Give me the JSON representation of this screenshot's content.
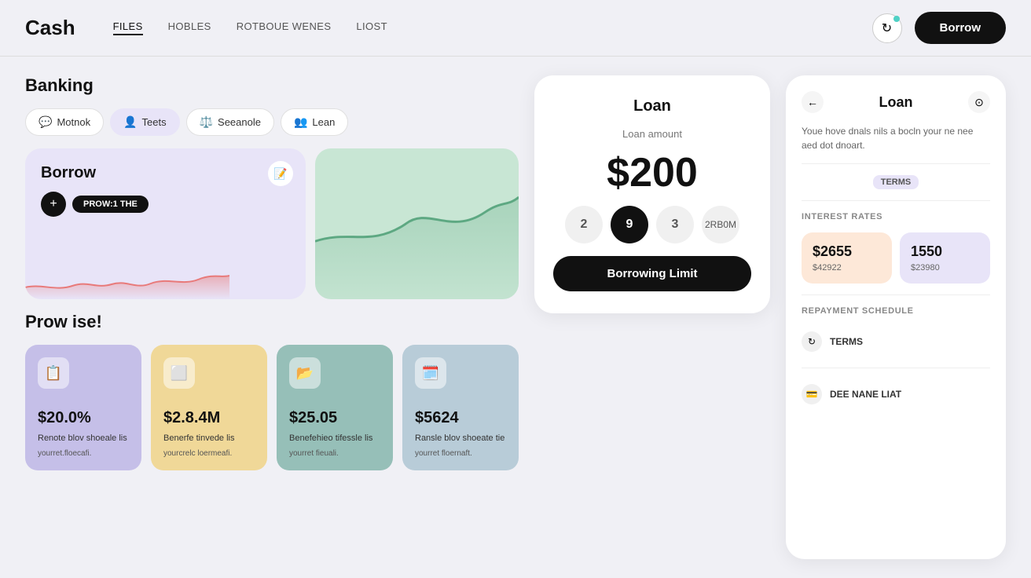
{
  "header": {
    "logo": "Cash",
    "nav": [
      {
        "label": "FILES",
        "active": true
      },
      {
        "label": "HOBLES",
        "active": false
      },
      {
        "label": "ROTBOUE WENES",
        "active": false
      },
      {
        "label": "LIOST",
        "active": false
      }
    ],
    "borrow_label": "Borrow"
  },
  "banking": {
    "title": "Banking",
    "tabs": [
      {
        "label": "Motnok",
        "icon": "💬",
        "active": false
      },
      {
        "label": "Teets",
        "icon": "👤",
        "active": true
      },
      {
        "label": "Seeanole",
        "icon": "⚖️",
        "active": false
      },
      {
        "label": "Lean",
        "icon": "👥",
        "active": false
      }
    ]
  },
  "borrow_card": {
    "title": "Borrow",
    "pill_label": "PROW:1 THE"
  },
  "loan_modal": {
    "title": "Loan",
    "amount_label": "Loan amount",
    "amount": "$200",
    "options": [
      "2",
      "9",
      "3",
      "2RB0M"
    ],
    "selected_option": "9",
    "cta_label": "Borrowing Limit"
  },
  "right_panel": {
    "title": "Loan",
    "description": "Youe hove dnals nils a bocln your ne nee aed dot dnoart.",
    "terms_badge": "TERMS",
    "interest_rates_title": "INTEREST RATES",
    "rate1": {
      "amount": "$2655",
      "sub": "$42922"
    },
    "rate2": {
      "amount": "1550",
      "sub": "$23980"
    },
    "repayment_title": "REPAYMENT SCHEDULE",
    "repayment_terms": "TERMS",
    "repayment_second": "DEE NANE LIAT"
  },
  "promise": {
    "title": "Prow ise!",
    "cards": [
      {
        "color": "purple",
        "amount": "$20.0%",
        "label": "Renote blov shoeale lis",
        "sub": "yourret.floecafi.",
        "icon": "📋"
      },
      {
        "color": "yellow",
        "amount": "$2.8.4M",
        "label": "Benerfe tinvede lis",
        "sub": "yourcrelc loermeafi.",
        "icon": "⬜"
      },
      {
        "color": "teal",
        "amount": "$25.05",
        "label": "Benefehieo tifessle lis",
        "sub": "yourret fieuali.",
        "icon": "📂"
      },
      {
        "color": "blue",
        "amount": "$5624",
        "label": "Ransle blov shoeate tie",
        "sub": "yourret floernaft.",
        "icon": "🗓️"
      }
    ]
  }
}
